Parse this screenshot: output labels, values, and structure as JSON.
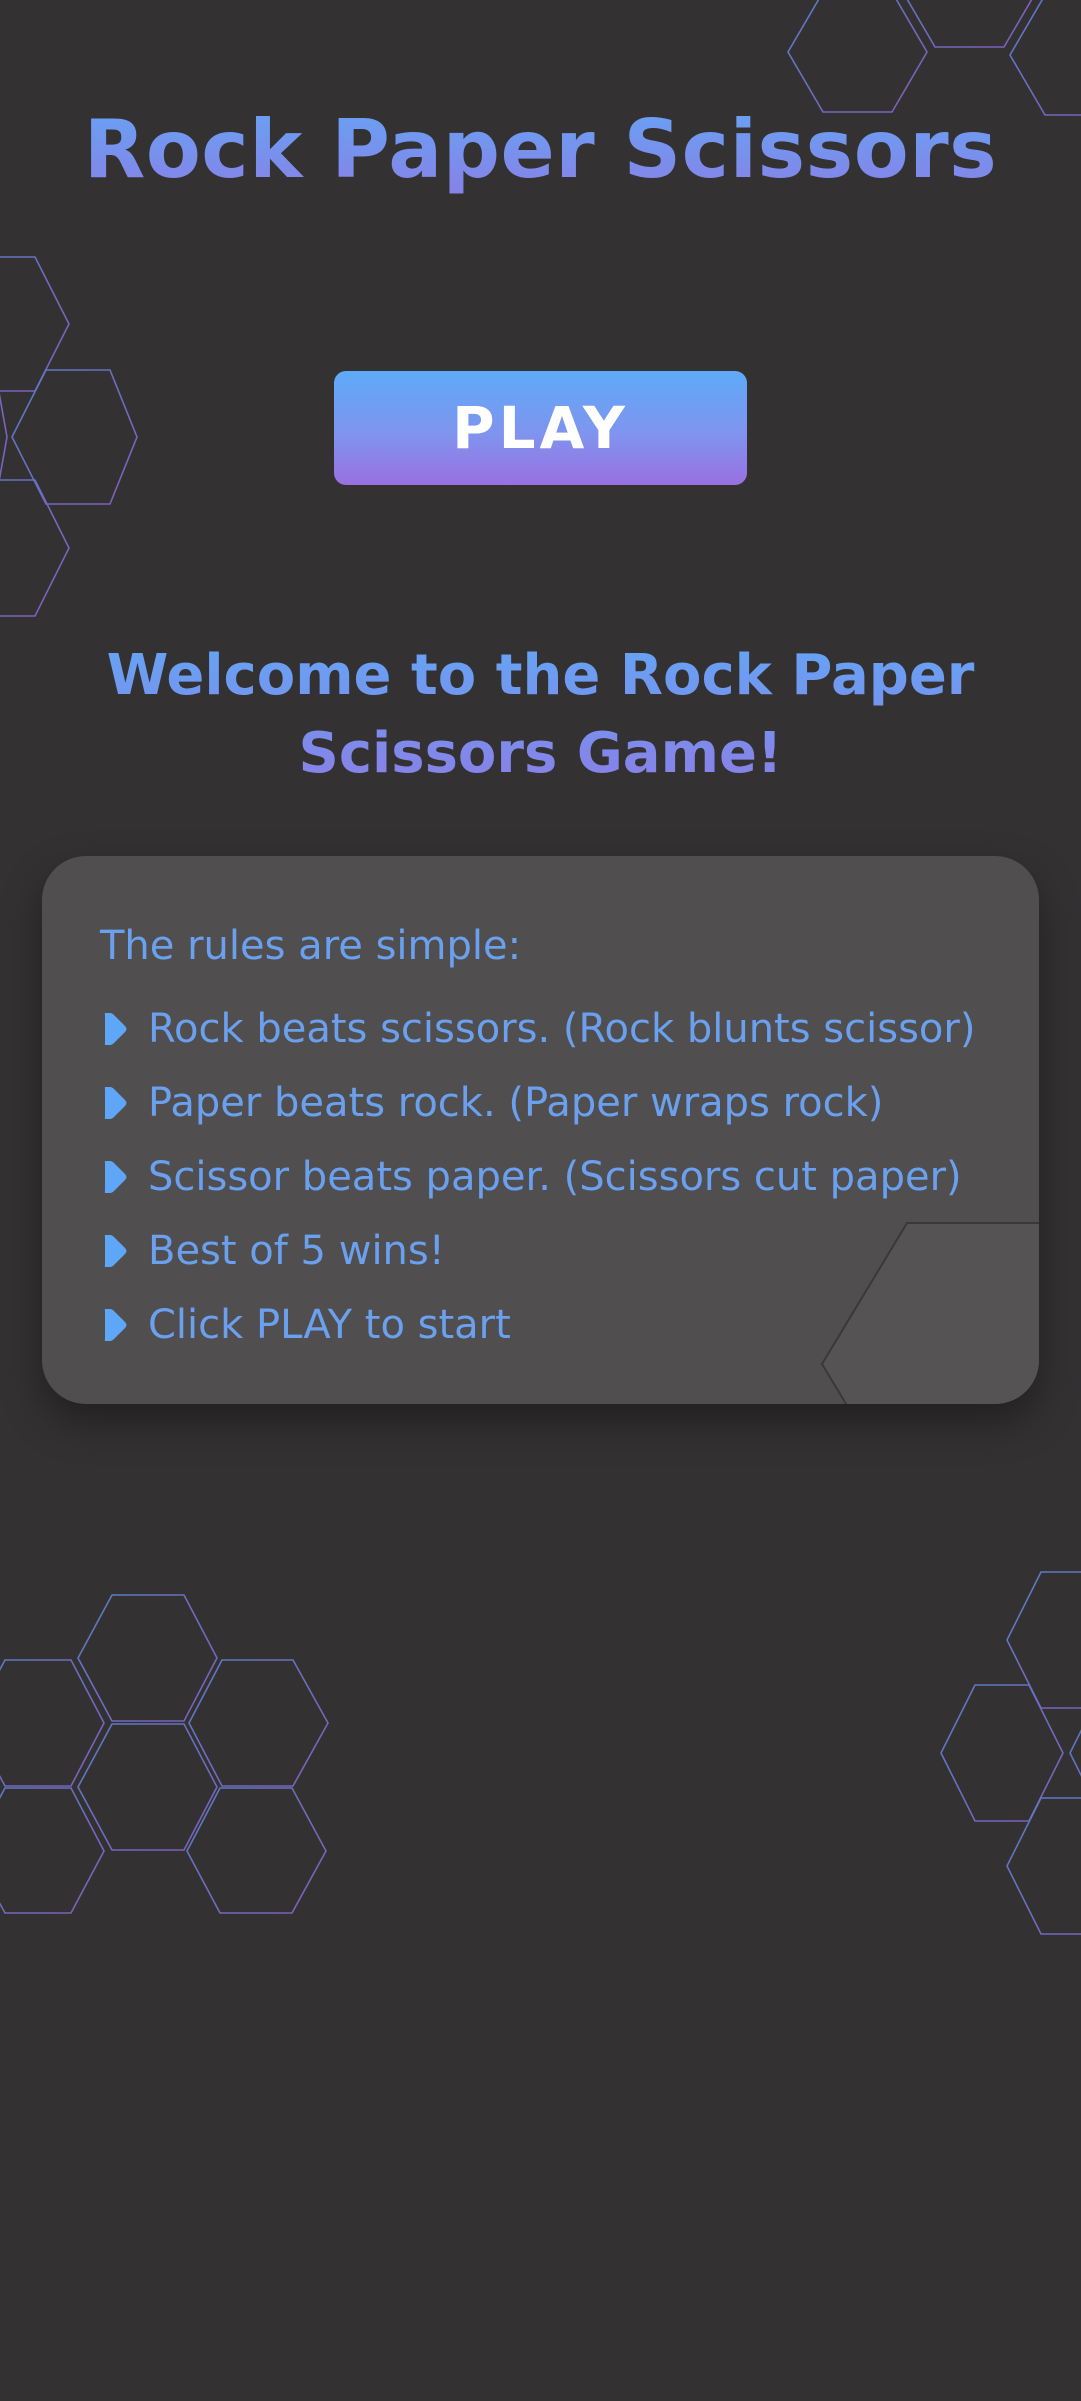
{
  "header": {
    "title": "Rock Paper Scissors"
  },
  "play_button": {
    "label": "PLAY"
  },
  "welcome": {
    "line1": "Welcome to the Rock Paper",
    "line2": "Scissors Game!"
  },
  "rules": {
    "intro": "The rules are simple:",
    "items": [
      {
        "text": "Rock beats scissors. (Rock blunts scissor)",
        "icon": "arrow-bullet-icon"
      },
      {
        "text": "Paper beats rock. (Paper wraps rock)",
        "icon": "arrow-bullet-icon"
      },
      {
        "text": "Scissor beats paper. (Scissors cut paper)",
        "icon": "arrow-bullet-icon"
      },
      {
        "text": "Best of 5 wins!",
        "icon": "arrow-bullet-icon"
      },
      {
        "text": "Click PLAY to start",
        "icon": "arrow-bullet-icon"
      }
    ]
  },
  "theme": {
    "background": "#333132",
    "card": "#504e4f",
    "accent_blue": "#63a6f5",
    "accent_purple": "#9970e1",
    "button_text": "#ffffff"
  }
}
